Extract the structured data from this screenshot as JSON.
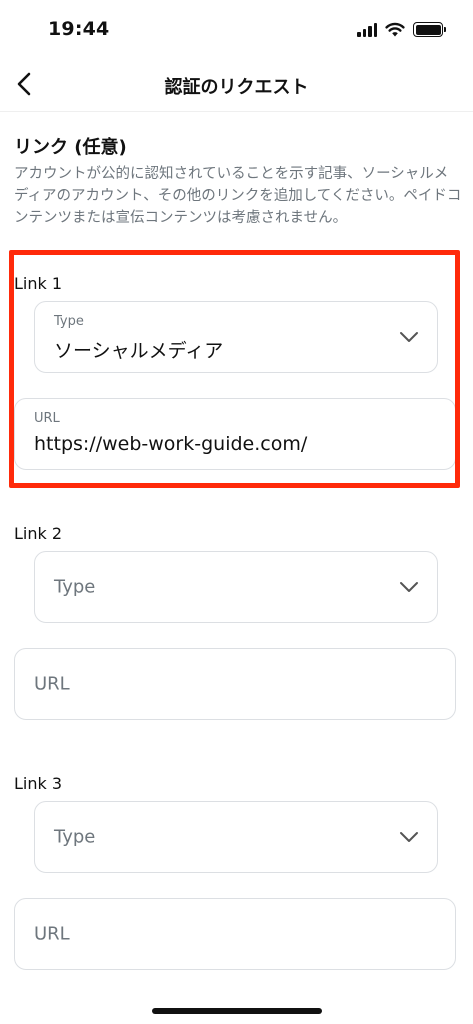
{
  "status_bar": {
    "time": "19:44"
  },
  "nav": {
    "title": "認証のリクエスト",
    "back_icon": "chevron-left-icon"
  },
  "section": {
    "title": "リンク (任意)",
    "description": "アカウントが公的に認知されていることを示す記事、ソーシャルメディアのアカウント、その他のリンクを追加してください。ペイドコンテンツまたは宣伝コンテンツは考慮されません。"
  },
  "links": [
    {
      "label": "Link 1",
      "type_label": "Type",
      "type_value": "ソーシャルメディア",
      "url_label": "URL",
      "url_value": "https://web-work-guide.com/"
    },
    {
      "label": "Link 2",
      "type_placeholder": "Type",
      "url_placeholder": "URL"
    },
    {
      "label": "Link 3",
      "type_placeholder": "Type",
      "url_placeholder": "URL"
    }
  ],
  "colors": {
    "highlight": "#ff2a0a",
    "muted_text": "#6e767d",
    "field_border": "#dcdfe3"
  }
}
